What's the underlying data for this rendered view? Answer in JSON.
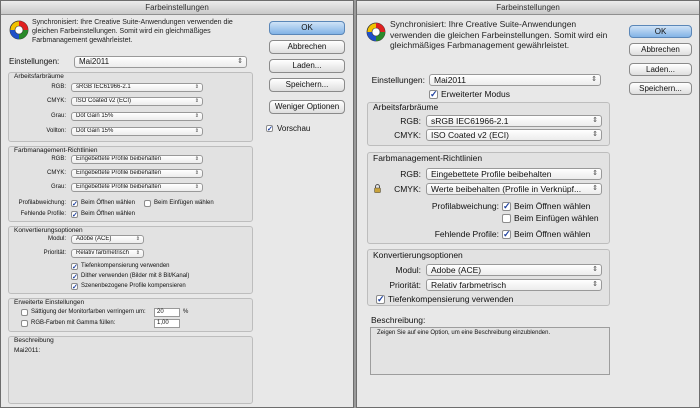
{
  "window_title": "Farbeinstellungen",
  "left": {
    "sync_note": "Synchronisiert: Ihre Creative Suite-Anwendungen verwenden die gleichen Farbeinstellungen. Somit wird ein gleichmäßiges Farbmanagement gewährleistet.",
    "buttons": {
      "ok": "OK",
      "cancel": "Abbrechen",
      "load": "Laden...",
      "save": "Speichern...",
      "fewer": "Weniger Optionen"
    },
    "preview_label": "Vorschau",
    "settings": {
      "label": "Einstellungen:",
      "value": "Mai2011"
    },
    "workspaces": {
      "title": "Arbeitsfarbräume",
      "rgb": {
        "label": "RGB:",
        "value": "sRGB IEC61966-2.1"
      },
      "cmyk": {
        "label": "CMYK:",
        "value": "ISO Coated v2 (ECI)"
      },
      "gray": {
        "label": "Grau:",
        "value": "Dot Gain 15%"
      },
      "spot": {
        "label": "Vollton:",
        "value": "Dot Gain 15%"
      }
    },
    "policies": {
      "title": "Farbmanagement-Richtlinien",
      "rgb": {
        "label": "RGB:",
        "value": "Eingebettete Profile beibehalten"
      },
      "cmyk": {
        "label": "CMYK:",
        "value": "Eingebettete Profile beibehalten"
      },
      "gray": {
        "label": "Grau:",
        "value": "Eingebettete Profile beibehalten"
      },
      "mismatch_label": "Profilabweichung:",
      "mismatch_open": "Beim Öffnen wählen",
      "mismatch_paste": "Beim Einfügen wählen",
      "missing_label": "Fehlende Profile:",
      "missing_open": "Beim Öffnen wählen"
    },
    "conversion": {
      "title": "Konvertierungsoptionen",
      "engine": {
        "label": "Modul:",
        "value": "Adobe (ACE)"
      },
      "intent": {
        "label": "Priorität:",
        "value": "Relativ farbmetrisch"
      },
      "bpc": "Tiefenkompensierung verwenden",
      "dither": "Dither verwenden (Bilder mit 8 Bit/Kanal)",
      "scene": "Szenenbezogene Profile kompensieren"
    },
    "advanced": {
      "title": "Erweiterte Einstellungen",
      "desaturate": "Sättigung der Monitorfarben verringern um:",
      "desaturate_value": "20",
      "desaturate_unit": "%",
      "blend": "RGB-Farben mit Gamma füllen:",
      "blend_value": "1,00"
    },
    "description": {
      "title": "Beschreibung",
      "text": "Mai2011:"
    }
  },
  "right": {
    "sync_note": "Synchronisiert: Ihre Creative Suite-Anwendungen verwenden die gleichen Farbeinstellungen. Somit wird ein gleichmäßiges Farbmanagement gewährleistet.",
    "buttons": {
      "ok": "OK",
      "cancel": "Abbrechen",
      "load": "Laden...",
      "save": "Speichern..."
    },
    "settings": {
      "label": "Einstellungen:",
      "value": "Mai2011"
    },
    "advanced_mode": "Erweiterter Modus",
    "workspaces": {
      "title": "Arbeitsfarbräume",
      "rgb": {
        "label": "RGB:",
        "value": "sRGB IEC61966-2.1"
      },
      "cmyk": {
        "label": "CMYK:",
        "value": "ISO Coated v2 (ECI)"
      }
    },
    "policies": {
      "title": "Farbmanagement-Richtlinien",
      "rgb": {
        "label": "RGB:",
        "value": "Eingebettete Profile beibehalten"
      },
      "cmyk": {
        "label": "CMYK:",
        "value": "Werte beibehalten (Profile in Verknüpf..."
      },
      "mismatch_label": "Profilabweichung:",
      "mismatch_open": "Beim Öffnen wählen",
      "mismatch_paste": "Beim Einfügen wählen",
      "missing_label": "Fehlende Profile:",
      "missing_open": "Beim Öffnen wählen"
    },
    "conversion": {
      "title": "Konvertierungsoptionen",
      "engine": {
        "label": "Modul:",
        "value": "Adobe (ACE)"
      },
      "intent": {
        "label": "Priorität:",
        "value": "Relativ farbmetrisch"
      },
      "bpc": "Tiefenkompensierung verwenden"
    },
    "description": {
      "title": "Beschreibung:",
      "text": "Zeigen Sie auf eine Option, um eine Beschreibung einzublenden."
    }
  }
}
